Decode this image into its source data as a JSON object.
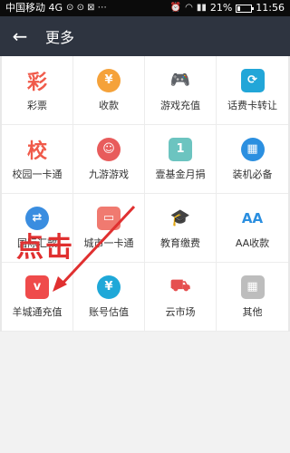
{
  "status_bar": {
    "carrier": "中国移动 4G",
    "battery": "21%",
    "battery_level": 0.21,
    "time": "11:56"
  },
  "header": {
    "back_icon": "arrow-left-icon",
    "title": "更多"
  },
  "grid": [
    {
      "label": "彩票",
      "icon": "lottery-icon",
      "glyph": "彩",
      "color": "#f05a4a"
    },
    {
      "label": "收款",
      "icon": "receive-money-icon",
      "glyph": "¥",
      "color": "#f5a23a"
    },
    {
      "label": "游戏充值",
      "icon": "gamepad-icon",
      "glyph": "🎮",
      "color": "#f0645a"
    },
    {
      "label": "话费卡转让",
      "icon": "card-transfer-icon",
      "glyph": "⟳",
      "color": "#22a6d8"
    },
    {
      "label": "校园一卡通",
      "icon": "campus-card-icon",
      "glyph": "校",
      "color": "#f05a4a"
    },
    {
      "label": "九游游戏",
      "icon": "jiuyou-game-icon",
      "glyph": "☺",
      "color": "#e85c5c"
    },
    {
      "label": "壹基金月捐",
      "icon": "charity-icon",
      "glyph": "1",
      "color": "#6cc4c0"
    },
    {
      "label": "装机必备",
      "icon": "app-grid-icon",
      "glyph": "▦",
      "color": "#2b8fe0"
    },
    {
      "label": "国际汇款",
      "icon": "remittance-icon",
      "glyph": "⇄",
      "color": "#3a8de0"
    },
    {
      "label": "城市一卡通",
      "icon": "city-card-icon",
      "glyph": "▭",
      "color": "#f07a70"
    },
    {
      "label": "教育缴费",
      "icon": "graduation-cap-icon",
      "glyph": "🎓",
      "color": "#e84b4b"
    },
    {
      "label": "AA收款",
      "icon": "aa-icon",
      "glyph": "AA",
      "color": "#2b8fe0"
    },
    {
      "label": "羊城通充值",
      "icon": "yangchengtong-icon",
      "glyph": "v",
      "color": "#ef4b4b"
    },
    {
      "label": "账号估值",
      "icon": "shield-yen-icon",
      "glyph": "¥",
      "color": "#1fa8d8"
    },
    {
      "label": "云市场",
      "icon": "cloud-market-icon",
      "glyph": "⛟",
      "color": "#e55050"
    },
    {
      "label": "其他",
      "icon": "more-grid-icon",
      "glyph": "▦",
      "color": "#bdbdbd"
    }
  ],
  "annotation": {
    "text": "点击",
    "color": "#e03030"
  }
}
